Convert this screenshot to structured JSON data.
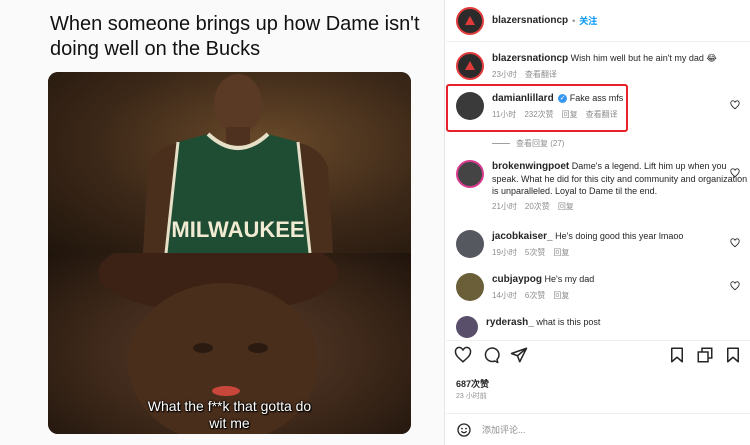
{
  "meme": {
    "caption": "When someone brings up how Dame isn't doing well on the Bucks",
    "subtitle_line1": "What the f**k that gotta do",
    "subtitle_line2": "wit me",
    "jersey_text": "MILWAUKEE"
  },
  "post": {
    "username": "blazersnationcp",
    "follow_label": "关注",
    "separator": "•"
  },
  "comments": [
    {
      "user": "blazersnationcp",
      "text": "Wish him well but he ain't my dad 😂",
      "time": "23小时",
      "likes": "",
      "reply": "",
      "translate": "查看翻译"
    },
    {
      "user": "damianlillard",
      "text": "Fake ass mfs",
      "time": "11小时",
      "likes": "232次赞",
      "reply": "回复",
      "translate": "查看翻译"
    },
    {
      "user": "brokenwingpoet",
      "text": "Dame's a legend. Lift him up when you speak. What he did for this city and community and organization is unparalleled. Loyal to Dame til the end.",
      "time": "21小时",
      "likes": "20次赞",
      "reply": "回复",
      "translate": ""
    },
    {
      "user": "jacobkaiser_",
      "text": "He's doing good this year lmaoo",
      "time": "19小时",
      "likes": "5次赞",
      "reply": "回复",
      "translate": ""
    },
    {
      "user": "cubjaypog",
      "text": "He's my dad",
      "time": "14小时",
      "likes": "6次赞",
      "reply": "回复",
      "translate": ""
    },
    {
      "user": "ryderash_",
      "text": "what is this post",
      "time": "",
      "likes": "",
      "reply": "",
      "translate": ""
    }
  ],
  "view_replies": "查看回复 (27)",
  "footer": {
    "likes": "687次赞",
    "time": "23 小时前",
    "add_comment_placeholder": "添加评论..."
  },
  "colors": {
    "highlight": "#e8202a",
    "follow": "#0095f6",
    "verified": "#3897f0"
  }
}
